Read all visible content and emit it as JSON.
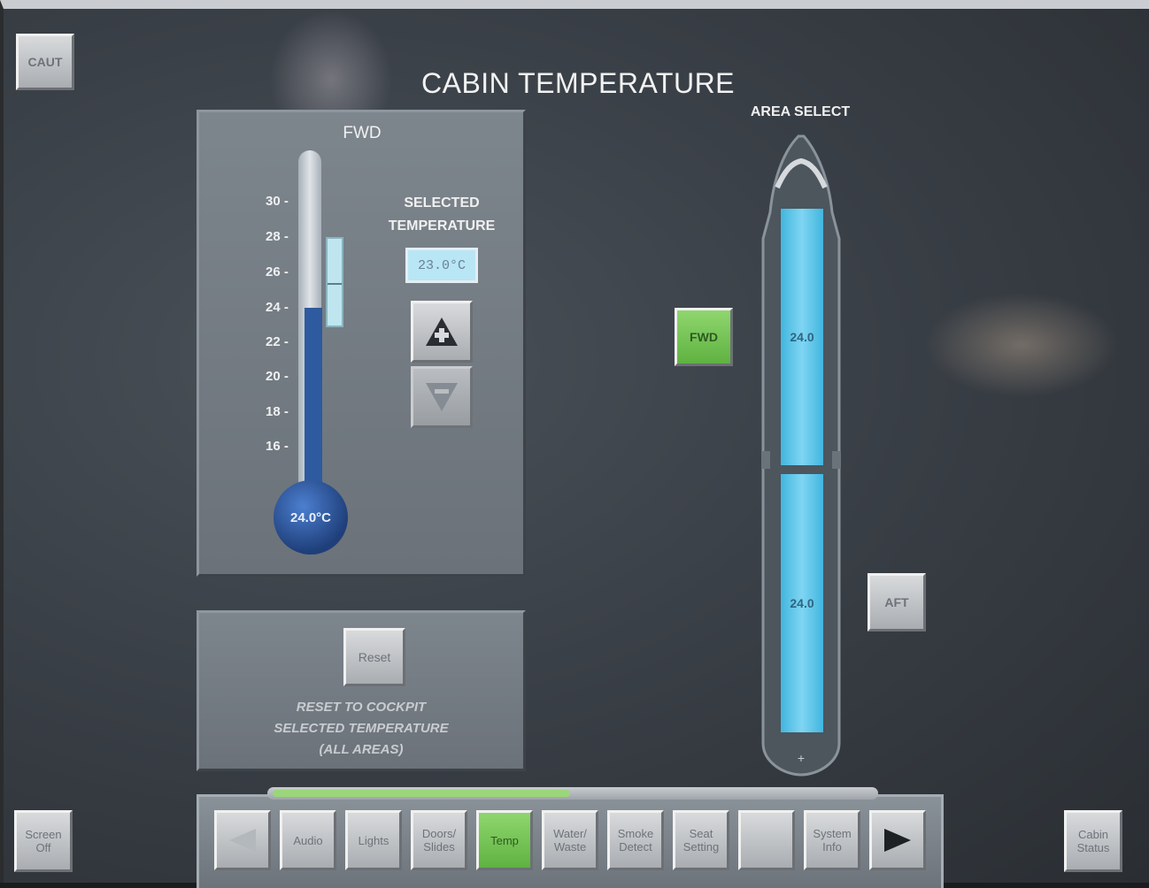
{
  "screen": {
    "title": "CABIN TEMPERATURE"
  },
  "top_left_button": {
    "label": "CAUT"
  },
  "zone_panel": {
    "zone_name": "FWD",
    "scale_ticks": [
      "30",
      "28",
      "26",
      "24",
      "22",
      "20",
      "18",
      "16"
    ],
    "current_temp": "24.0°C",
    "selected_label_line1": "SELECTED",
    "selected_label_line2": "TEMPERATURE",
    "selected_value": "23.0°C",
    "thermometer_level_c": 24.0,
    "selected_band_c": [
      23.0,
      27.0
    ]
  },
  "reset_panel": {
    "button_label": "Reset",
    "desc_line1": "RESET TO COCKPIT",
    "desc_line2": "SELECTED TEMPERATURE",
    "desc_line3": "(ALL AREAS)"
  },
  "area_select": {
    "label": "AREA SELECT",
    "fwd_button": "FWD",
    "aft_button": "AFT",
    "fwd_zone_temp": "24.0",
    "aft_zone_temp": "24.0",
    "selected_area": "FWD"
  },
  "nav": {
    "items": [
      "Audio",
      "Lights",
      "Doors/\nSlides",
      "Temp",
      "Water/\nWaste",
      "Smoke\nDetect",
      "Seat\nSetting",
      "",
      "System\nInfo"
    ],
    "active": "Temp",
    "progress": 0.48
  },
  "bottom_left_button": {
    "label": "Screen\nOff"
  },
  "bottom_right_button": {
    "label": "Cabin\nStatus"
  },
  "colors": {
    "active_green": "#6cc04a",
    "cabin_blue": "#4dbfe5",
    "mercury": "#2e5aa0"
  }
}
